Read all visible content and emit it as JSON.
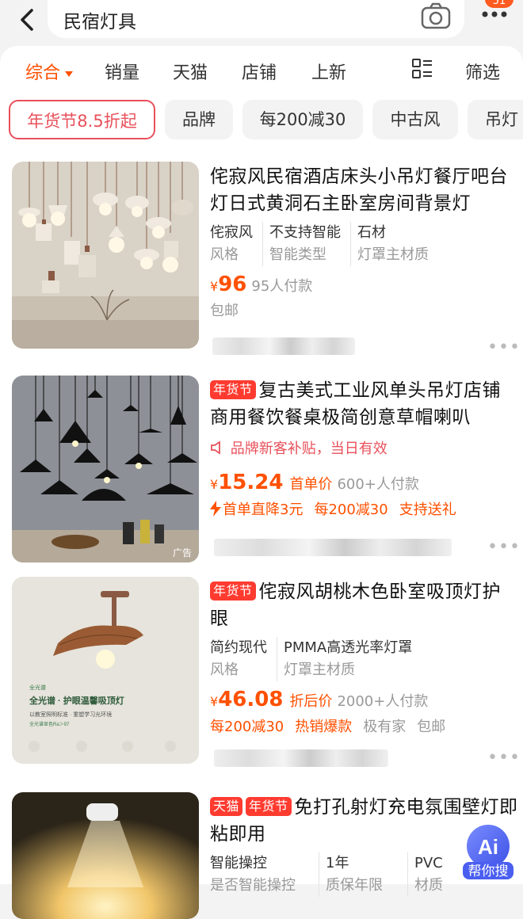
{
  "header": {
    "query": "民宿灯具",
    "notif_count": "51"
  },
  "sort_tabs": [
    {
      "label": "综合"
    },
    {
      "label": "销量"
    },
    {
      "label": "天猫"
    },
    {
      "label": "店铺"
    },
    {
      "label": "上新"
    },
    {
      "label": "筛选"
    }
  ],
  "chips": [
    "年货节8.5折起",
    "品牌",
    "每200减30",
    "中古风",
    "吊灯"
  ],
  "products": [
    {
      "title": "侘寂风民宿酒店床头小吊灯餐厅吧台灯日式黄洞石主卧室房间背景灯",
      "attrs": [
        {
          "v": "侘寂风",
          "k": "风格"
        },
        {
          "v": "不支持智能",
          "k": "智能类型"
        },
        {
          "v": "石材",
          "k": "灯罩主材质"
        }
      ],
      "price": "96",
      "sold": "95人付款",
      "shipping": "包邮"
    },
    {
      "tag": "年货节",
      "title": "复古美式工业风单头吊灯店铺商用餐饮餐桌极简创意草帽喇叭",
      "notice": "品牌新客补贴，当日有效",
      "price": "15.24",
      "price_label": "首单价",
      "sold": "600+人付款",
      "promos": [
        "首单直降3元",
        "每200减30",
        "支持送礼"
      ],
      "ad": "广告"
    },
    {
      "tag": "年货节",
      "title": "侘寂风胡桃木色卧室吸顶灯护眼",
      "attrs": [
        {
          "v": "简约现代",
          "k": "风格"
        },
        {
          "v": "PMMA高透光率灯罩",
          "k": "灯罩主材质"
        }
      ],
      "price": "46.08",
      "price_label": "折后价",
      "sold": "2000+人付款",
      "promos": [
        "每200减30",
        "热销爆款"
      ],
      "extra": [
        "极有家",
        "包邮"
      ],
      "thumb_text": {
        "brand": "全光谱 · 护眼温馨吸顶灯",
        "sub": "以教室照明标准 · 重塑学习光环境",
        "small": "全光谱显色Ra＞97"
      }
    },
    {
      "tags": [
        "天猫",
        "年货节"
      ],
      "title": "免打孔射灯充电氛围壁灯即粘即用",
      "attrs": [
        {
          "v": "智能操控",
          "k": "是否智能操控"
        },
        {
          "v": "1年",
          "k": "质保年限"
        },
        {
          "v": "PVC",
          "k": "材质"
        }
      ]
    }
  ],
  "ai": {
    "label": "Ai",
    "caption": "帮你搜"
  },
  "colors": {
    "accent": "#ff5000",
    "tag_red": "#ff3b30",
    "chip_red": "#e8505b"
  }
}
